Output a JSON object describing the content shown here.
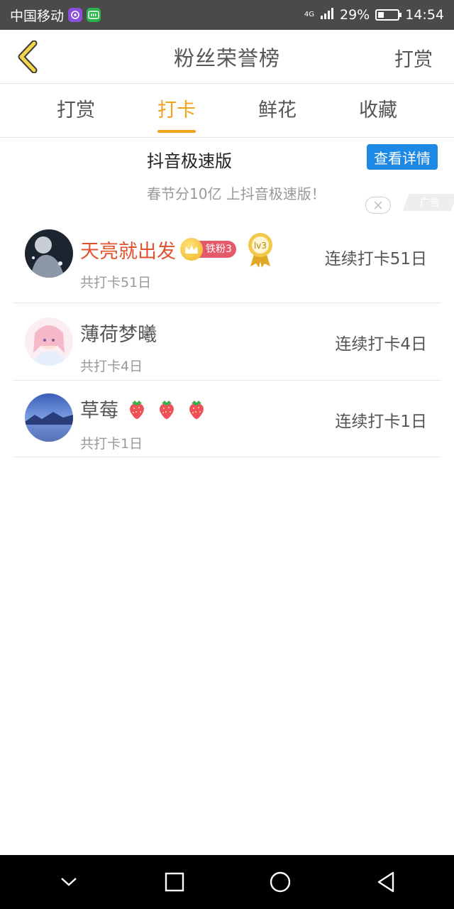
{
  "status_bar": {
    "carrier": "中国移动",
    "network": "4G",
    "battery_percent": "29%",
    "battery_level": 0.29,
    "time": "14:54",
    "icons": [
      "podcast-app-icon",
      "iqiyi-app-icon",
      "signal-icon",
      "battery-icon"
    ]
  },
  "header": {
    "title": "粉丝荣誉榜",
    "action_label": "打赏",
    "back_icon": "chevron-left-icon",
    "accent_color": "#f3a21b"
  },
  "tabs": [
    {
      "label": "打赏",
      "active": false
    },
    {
      "label": "打卡",
      "active": true
    },
    {
      "label": "鲜花",
      "active": false
    },
    {
      "label": "收藏",
      "active": false
    }
  ],
  "ad": {
    "title": "抖音极速版",
    "subtitle": "春节分10亿  上抖音极速版！",
    "button_label": "查看详情",
    "tag": "广告",
    "button_color": "#1e88e5"
  },
  "list": [
    {
      "name": "天亮就出发",
      "total": "共打卡51日",
      "streak": "连续打卡51日",
      "fan_badge": "铁粉3",
      "level_badge": "lv3",
      "name_color": "#e2522e"
    },
    {
      "name": "薄荷梦曦",
      "total": "共打卡4日",
      "streak": "连续打卡4日"
    },
    {
      "name": "草莓",
      "total": "共打卡1日",
      "streak": "连续打卡1日",
      "emoji_icons": [
        "strawberry-icon",
        "strawberry-icon",
        "strawberry-icon"
      ]
    }
  ],
  "bottom_nav": [
    "chevron-down-icon",
    "square-icon",
    "circle-icon",
    "triangle-back-icon"
  ]
}
